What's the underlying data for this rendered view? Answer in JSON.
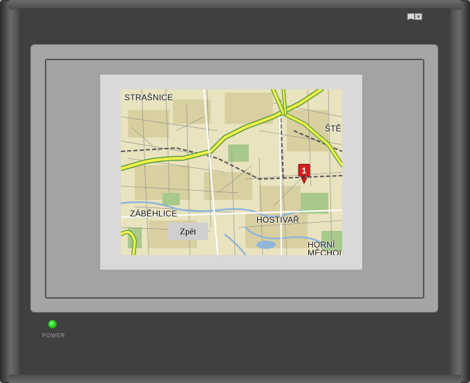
{
  "window": {
    "minimize_glyph": "‗",
    "close_glyph": "×"
  },
  "map": {
    "labels": {
      "strasnice": "STRAŠNICE",
      "steri": "ŠTĚ",
      "zabehlice": "ZÁBĚHLICE",
      "hostivar": "HOSTIVAŘ",
      "horni": "HORNÍ",
      "mecholupy": "MĚCHOLU"
    },
    "marker_number": "1"
  },
  "controls": {
    "back_label": "Zpět"
  },
  "device": {
    "power_label": "POWER"
  },
  "colors": {
    "map_background": "#e9e3bf",
    "road_major": "#f2f24a",
    "road_green_edge": "#5a9c3a",
    "water": "#8fb5da",
    "marker_red": "#d42020",
    "power_led": "#10c810"
  }
}
